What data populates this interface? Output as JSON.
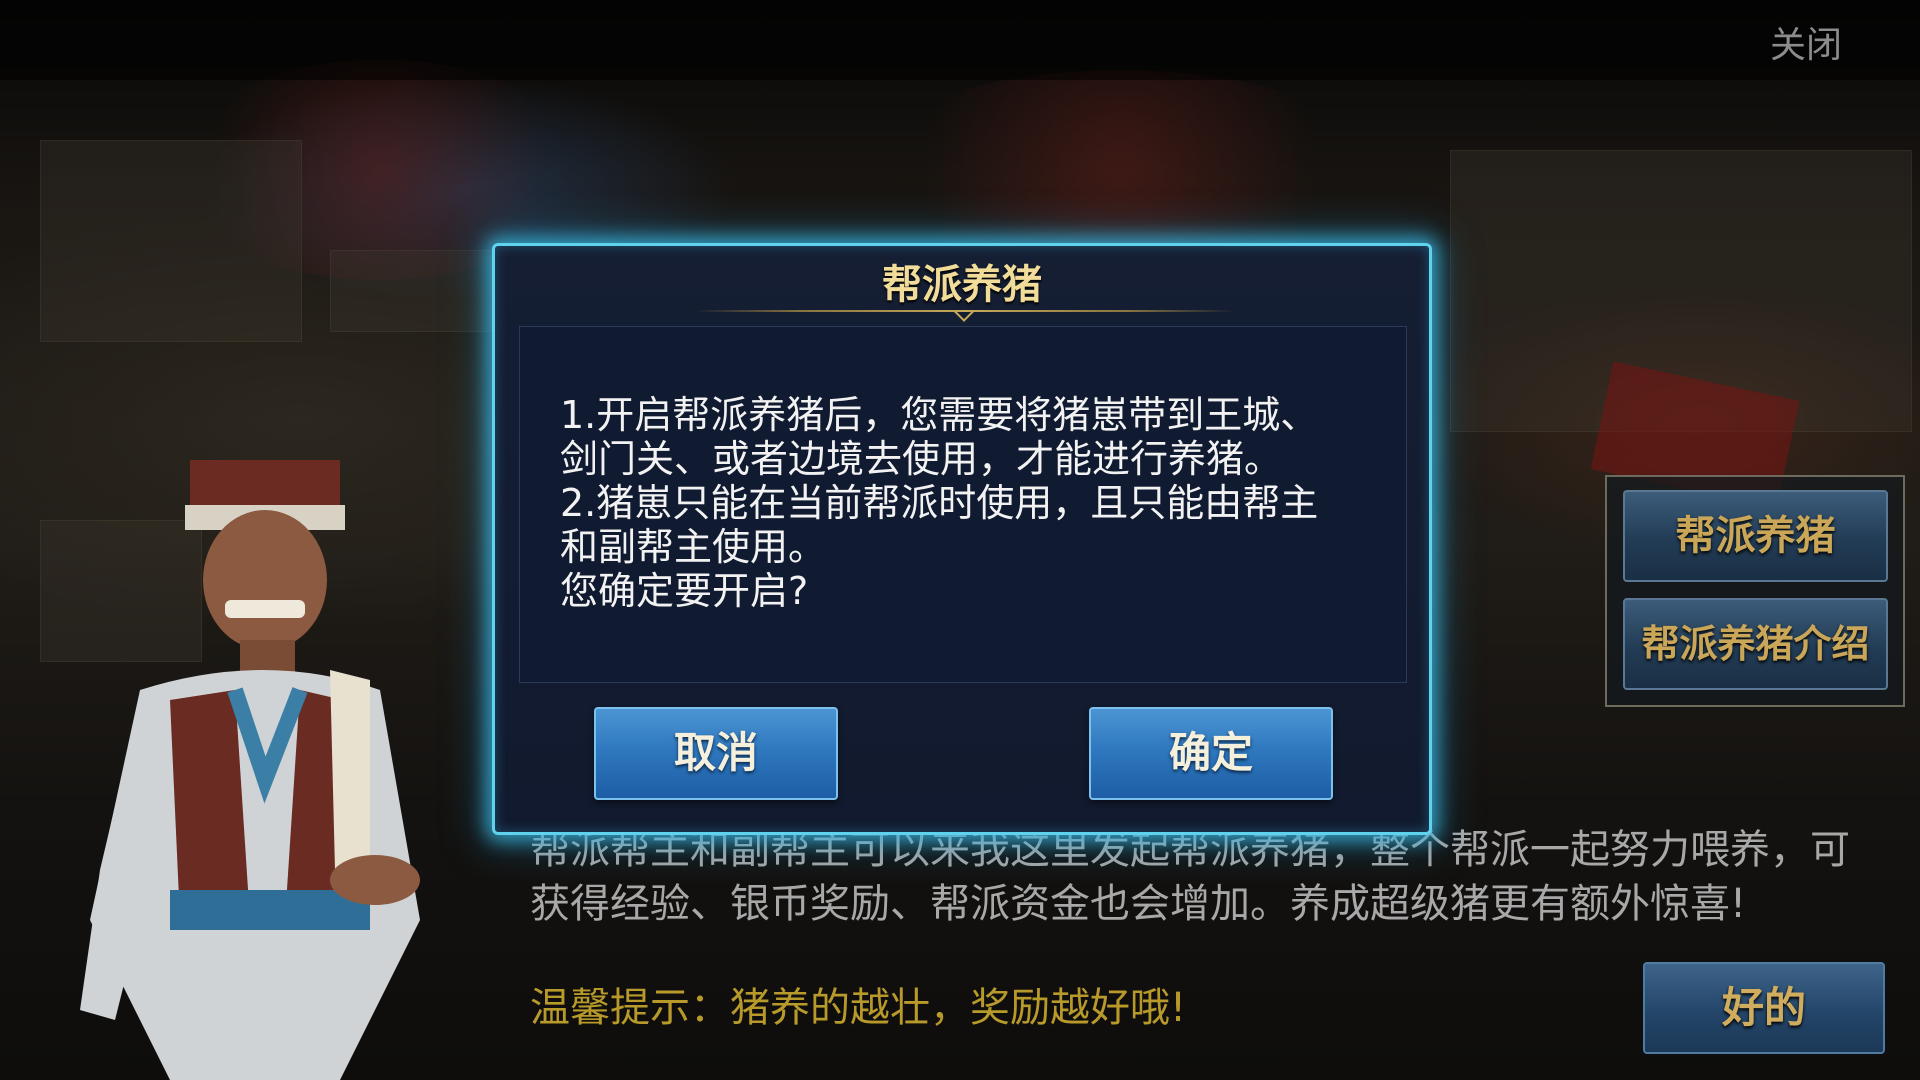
{
  "top_bar": {
    "close_label": "关闭"
  },
  "modal": {
    "title": "帮派养猪",
    "lines": [
      "1.开启帮派养猪后，您需要将猪崽带到王城、",
      "剑门关、或者边境去使用，才能进行养猪。",
      "2.猪崽只能在当前帮派时使用，且只能由帮主",
      "和副帮主使用。",
      "您确定要开启?"
    ],
    "cancel_label": "取消",
    "confirm_label": "确定"
  },
  "side_menu": {
    "items": [
      {
        "label": "帮派养猪"
      },
      {
        "label": "帮派养猪介绍"
      }
    ]
  },
  "npc_dialog": {
    "line1": "帮派帮主和副帮主可以来我这里发起帮派养猪，整个帮派一起努力喂养，可",
    "line2": "获得经验、银币奖励、帮派资金也会增加。养成超级猪更有额外惊喜!",
    "tip": "温馨提示：猪养的越壮，奖励越好哦!",
    "ok_label": "好的"
  },
  "colors": {
    "modal_border": "#5fd3ee",
    "title_gold": "#f1dc9a",
    "button_blue": "#2f78bf",
    "tip_gold": "#b89a2a"
  }
}
